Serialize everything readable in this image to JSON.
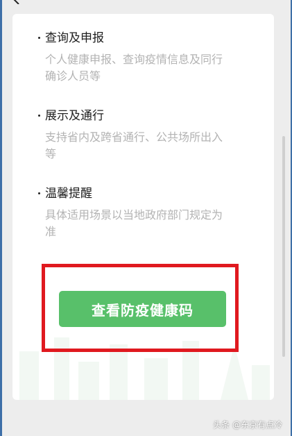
{
  "sections": [
    {
      "title": "查询及申报",
      "description": "个人健康申报、查询疫情信息及同行确诊人员等"
    },
    {
      "title": "展示及通行",
      "description": "支持省内及跨省通行、公共场所出入等"
    },
    {
      "title": "温馨提醒",
      "description": "具体适用场景以当地政府部门规定为准"
    }
  ],
  "cta": {
    "label": "查看防疫健康码"
  },
  "watermark": {
    "text": "头条 @东京有点冷"
  },
  "colors": {
    "accent": "#58c06a",
    "highlight": "#e0191f",
    "frame": "#3e6fa8"
  },
  "icons": {
    "back": "chevron-left-icon"
  }
}
